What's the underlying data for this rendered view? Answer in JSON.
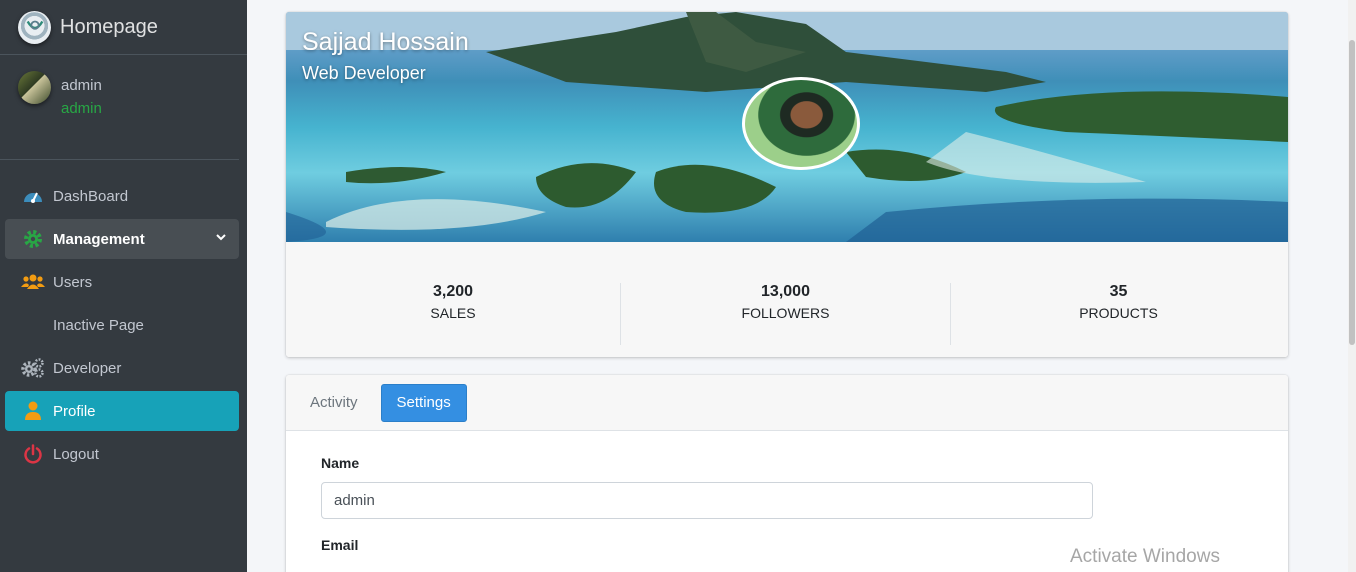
{
  "brand": {
    "title": "Homepage",
    "logo_icon": "homepage-logo-icon"
  },
  "user_panel": {
    "name": "admin",
    "role": "admin"
  },
  "sidebar": {
    "items": [
      {
        "label": "DashBoard",
        "icon": "dashboard-gauge-icon"
      },
      {
        "label": "Management",
        "icon": "gear-icon"
      },
      {
        "label": "Users",
        "icon": "users-icon"
      },
      {
        "label": "Inactive Page"
      },
      {
        "label": "Developer",
        "icon": "gears-icon"
      },
      {
        "label": "Profile",
        "icon": "user-icon"
      },
      {
        "label": "Logout",
        "icon": "power-icon"
      }
    ],
    "active_color": "#17a2b8"
  },
  "profile": {
    "name": "Sajjad Hossain",
    "description": "Web Developer",
    "stats": [
      {
        "value": "3,200",
        "label": "SALES"
      },
      {
        "value": "13,000",
        "label": "FOLLOWERS"
      },
      {
        "value": "35",
        "label": "PRODUCTS"
      }
    ]
  },
  "settings": {
    "tabs": [
      "Activity",
      "Settings"
    ],
    "active_tab": "Settings",
    "name_label": "Name",
    "name_value": "admin",
    "email_label": "Email"
  },
  "watermark": "Activate Windows",
  "colors": {
    "sidebar_bg": "#343a40",
    "accent_blue": "#348fe2",
    "success_green": "#28a745"
  }
}
